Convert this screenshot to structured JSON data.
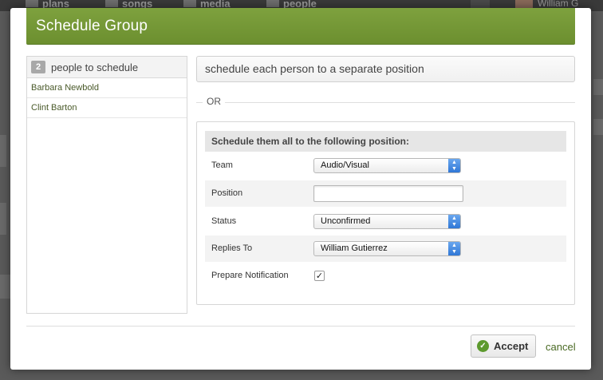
{
  "background": {
    "nav_tabs": [
      {
        "label": "plans",
        "icon": "list-icon"
      },
      {
        "label": "songs",
        "icon": "music-icon"
      },
      {
        "label": "media",
        "icon": "film-icon"
      },
      {
        "label": "people",
        "icon": "people-icon"
      }
    ],
    "user_name": "William G"
  },
  "modal": {
    "title": "Schedule Group",
    "header_color": "#739636",
    "people": {
      "count": "2",
      "header_label": "people to schedule",
      "items": [
        "Barbara Newbold",
        "Clint Barton"
      ]
    },
    "separate_option": "schedule each person to a separate position",
    "or_label": "OR",
    "form": {
      "heading": "Schedule them all to the following position:",
      "team_label": "Team",
      "team_value": "Audio/Visual",
      "position_label": "Position",
      "position_value": "",
      "status_label": "Status",
      "status_value": "Unconfirmed",
      "replies_label": "Replies To",
      "replies_value": "William Gutierrez",
      "notify_label": "Prepare Notification",
      "notify_checked": true
    },
    "footer": {
      "accept_label": "Accept",
      "cancel_label": "cancel"
    }
  }
}
